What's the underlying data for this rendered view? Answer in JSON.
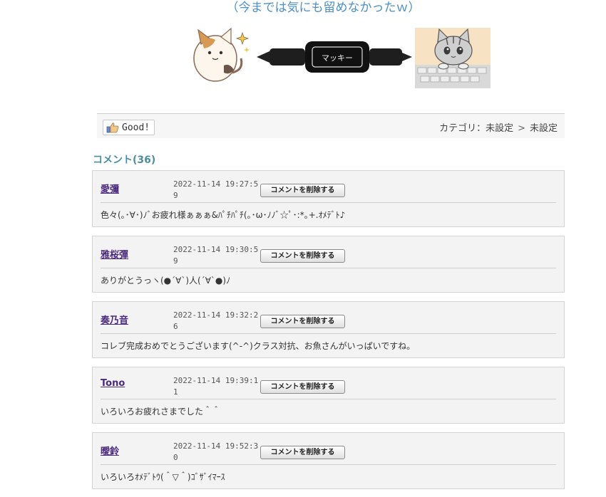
{
  "top_caption": "（今までは気にも留めなかったｗ）",
  "images": {
    "left": "calico-cat-illustration",
    "center": "black-marker-pen",
    "right": "kitten-at-keyboard"
  },
  "good_bar": {
    "good_label": "Good!",
    "category_prefix": "カテゴリ：未設定",
    "category_separator": ">",
    "category_sub": "未設定"
  },
  "comments_heading": "コメント(36)",
  "comments": [
    {
      "author": "愛彌",
      "date": "2022-11-14 19:27:59",
      "delete_label": "コメントを削除する",
      "text": "色々(｡･∀･)ﾉﾞお疲れ様ぁぁぁ&ﾊﾟﾁﾊﾟﾁ(｡･ω･ﾉﾉﾞ☆ﾟ･:*｡+.ｵﾒﾃﾞﾄ♪"
    },
    {
      "author": "雅桜彈",
      "date": "2022-11-14 19:30:59",
      "delete_label": "コメントを削除する",
      "text": "ありがとうっヽ(●´∀`)人(´∀`●)ﾉ"
    },
    {
      "author": "奏乃音",
      "date": "2022-11-14 19:32:26",
      "delete_label": "コメントを削除する",
      "text": "コレブ完成おめでとうございます(^-^)クラス対抗、お魚さんがいっぱいですね。"
    },
    {
      "author": "Tono",
      "date": "2022-11-14 19:39:11",
      "delete_label": "コメントを削除する",
      "text": "いろいろお疲れさまでした＾＾"
    },
    {
      "author": "曖鈴",
      "date": "2022-11-14 19:52:30",
      "delete_label": "コメントを削除する",
      "text": "いろいろｵﾒﾃﾞﾄｳ(＾▽＾)ｺﾞｻﾞｲﾏｰｽ"
    }
  ],
  "colors": {
    "caption": "#4d8fc4",
    "heading": "#4a8fa0",
    "author": "#4b2a7e",
    "comment_bg": "#f3f3f3"
  }
}
